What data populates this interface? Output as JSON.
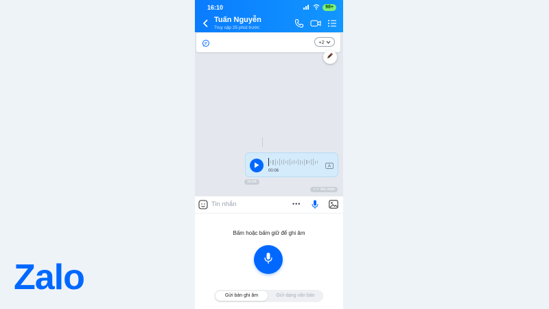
{
  "brand": {
    "logo_text": "Zalo",
    "accent": "#0068ff"
  },
  "status_bar": {
    "time": "16:10",
    "battery": "98+"
  },
  "header": {
    "contact_name": "Tuấn Nguyễn",
    "contact_status": "Truy cập 25 phút trước",
    "icons": [
      "back-icon",
      "phone-icon",
      "video-call-icon",
      "list-menu-icon"
    ]
  },
  "pinned_bar": {
    "more_label": "+2"
  },
  "voice_message": {
    "duration": "00:06",
    "sent_time": "16:04",
    "status": "Đã nhận"
  },
  "input_bar": {
    "placeholder": "Tin nhắn",
    "more_dots": "•••"
  },
  "recording_panel": {
    "hint": "Bấm hoặc bấm giữ để ghi âm",
    "modes": [
      {
        "label": "Gửi bản ghi âm",
        "active": true
      },
      {
        "label": "Gửi dạng văn bản",
        "active": false
      }
    ]
  }
}
